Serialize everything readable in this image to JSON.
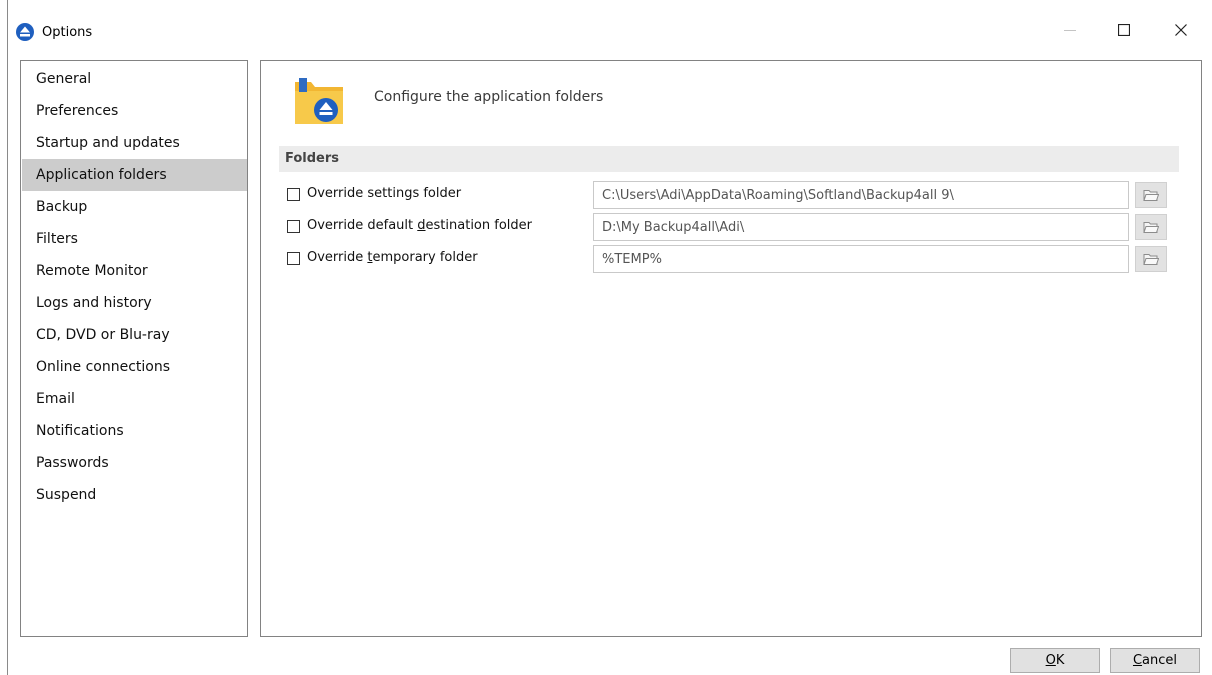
{
  "window": {
    "title": "Options",
    "minimize_icon": "minimize-icon",
    "maximize_icon": "maximize-icon",
    "close_icon": "close-icon"
  },
  "sidebar": {
    "selected": "Application folders",
    "items": [
      {
        "label": "General"
      },
      {
        "label": "Preferences"
      },
      {
        "label": "Startup and updates"
      },
      {
        "label": "Application folders"
      },
      {
        "label": "Backup"
      },
      {
        "label": "Filters"
      },
      {
        "label": "Remote Monitor"
      },
      {
        "label": "Logs and history"
      },
      {
        "label": "CD, DVD or Blu-ray"
      },
      {
        "label": "Online connections"
      },
      {
        "label": "Email"
      },
      {
        "label": "Notifications"
      },
      {
        "label": "Passwords"
      },
      {
        "label": "Suspend"
      }
    ]
  },
  "panel": {
    "header_text": "Configure the application folders",
    "header_icon": "folder-eject-icon",
    "section_title": "Folders",
    "rows": [
      {
        "label_before": "Override settings folder",
        "label_access": "",
        "label_after": "",
        "checked": false,
        "value": "C:\\Users\\Adi\\AppData\\Roaming\\Softland\\Backup4all 9\\",
        "browse_icon": "folder-open-icon"
      },
      {
        "label_before": "Override default ",
        "label_access": "d",
        "label_after": "estination folder",
        "checked": false,
        "value": "D:\\My Backup4all\\Adi\\",
        "browse_icon": "folder-open-icon"
      },
      {
        "label_before": "Override ",
        "label_access": "t",
        "label_after": "emporary folder",
        "checked": false,
        "value": "%TEMP%",
        "browse_icon": "folder-open-icon"
      }
    ]
  },
  "footer": {
    "ok_access": "O",
    "ok_rest": "K",
    "cancel_access": "C",
    "cancel_rest": "ancel"
  }
}
